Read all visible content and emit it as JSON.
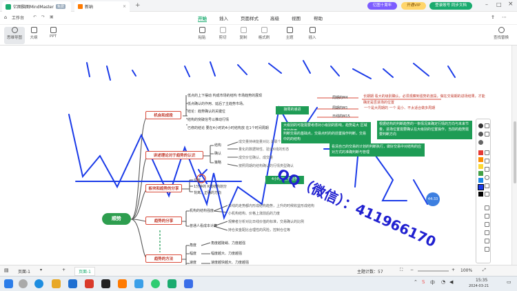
{
  "app": {
    "tab1": "亿图脑图MindMaster",
    "tab1_badge": "免费",
    "tab2": "新纳",
    "new_tab": "+"
  },
  "header": {
    "promo": "亿图十周年",
    "vip": "开通VIP",
    "login": "登录账号 同步文档"
  },
  "menubar": {
    "workspace": "工作台",
    "items": [
      "开始",
      "插入",
      "页面样式",
      "高级",
      "视图",
      "帮助"
    ]
  },
  "view_modes": [
    "思维导图",
    "大纲",
    "PPT"
  ],
  "ribbon": [
    "粘贴",
    "剪切",
    "复制",
    "格式刷",
    "主题",
    "插入"
  ],
  "ribbon_right": "查找替换",
  "mindmap": {
    "root": "顺势",
    "branches": [
      "机会和成段",
      "讲述理论对于趋势的认识",
      "板块和趋势的分享",
      "趋势的分享",
      "趋势的方法"
    ],
    "branch1_items": [
      "低点的上下摆动 构成市场的结构 市场趋势的展现",
      "低点确认的作用、延后了主趋势市场。",
      "结论：趋势确认的关键位",
      "结构的突破信号以推动行情",
      "已修的结论 要在4小时的4小时结构放 在1个时间周期"
    ],
    "branch2_items": [
      "结构",
      "确认",
      "策略"
    ],
    "branch2_details": [
      "成交量持续能量对比 关联个股价格等",
      "量化的数据特性、验证K线的形态",
      "成交价位确认、成交量",
      "按照周期的结构确认的行情类型确认"
    ],
    "branch3_items": [
      "位置",
      "1分钟的 K线结构划分",
      "背离、正确的方向"
    ],
    "branch4_items": [
      "机构的结构强度",
      "普通人看成本计算"
    ],
    "branch4_details": [
      "日线的走势都内形成结构趋势，上升的时候收益形成结构",
      "小机构结构、价格上涨前后的力度",
      "观察者分析对比日线价值的标准，交易确认的比例",
      "持仓资金配比合理性的风险，控制仓位等"
    ],
    "branch5_items": [
      "角度",
      "幅度",
      "速度"
    ],
    "branch5_details": [
      "角度越陡峭、力度越强",
      "幅度越大、力度越强",
      "速度越快越大、力度越强"
    ],
    "mid_box": "4小时的主要趋势",
    "lower_mid_box": "接周的递进",
    "relation": {
      "title": "接周的递进",
      "items": [
        "周期的M4",
        "周期的M1",
        "日线的M15"
      ],
      "right": "一个是大周期的 一个 是小、不太适合做多周期"
    },
    "red_note": [
      "长期期 看大的级别确认，必须观察到强势的波段，做在交易期的进场结果，才能",
      "确定是否进场的位置"
    ],
    "green_boxes": [
      "大级别的可能需要考虑对小级别的影响，趋势是大 区域 等的作用",
      "判断交易的基础点，交易点时的的前置操作判断，交易中的的结构",
      "根据结构的判断趋势的一条情况来确定行情的方向与未来节奏，进场位置需要确认在大级别的位置操作，当前的趋势需要判断方向",
      "看清自己的交易的计划的判断执行，做好交易中对结构的应对方式的准确判断与管理"
    ]
  },
  "watermark": "QQ（微信）：411966170",
  "time_bubble": "44:33",
  "statusbar": {
    "page": "页面-1",
    "page_tab": "页面-1",
    "topic_count": "主题计数：57",
    "zoom": "100%"
  },
  "taskbar": {
    "time": "15:35",
    "date": "2024-03-21",
    "ime": "中"
  },
  "colors": {
    "accent": "#1aab6f",
    "root": "#2e9e4f",
    "red": "#d94a3a",
    "annot": "#1a3ae8",
    "watermark": "#2020d0"
  }
}
